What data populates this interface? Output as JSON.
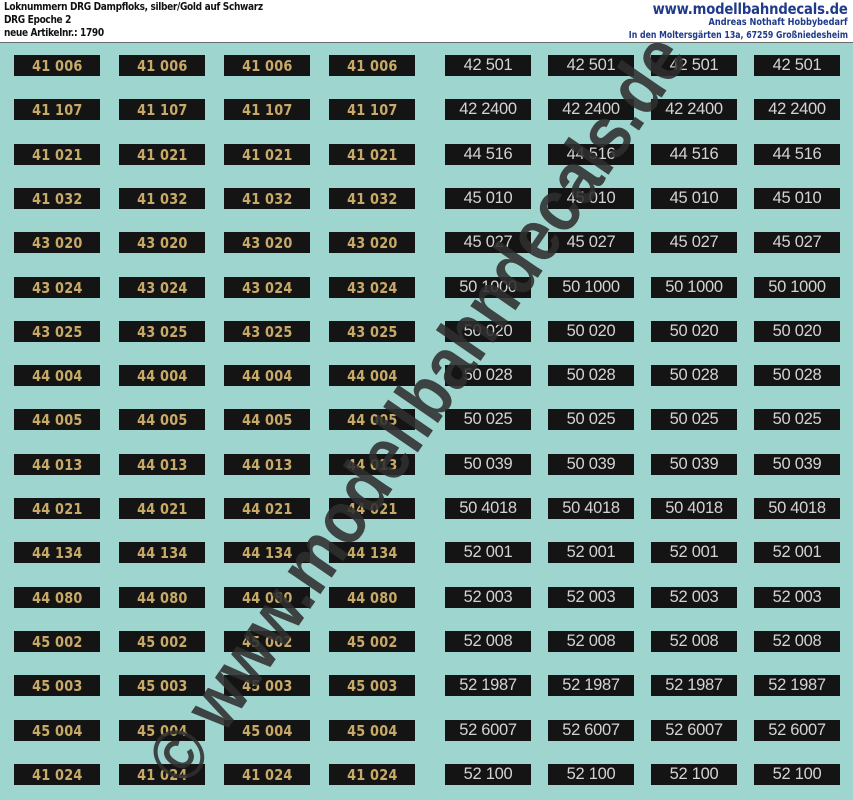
{
  "header": {
    "title_line1": "Loknummern DRG Dampfloks, silber/Gold auf Schwarz",
    "title_line2": "DRG Epoche 2",
    "title_line3": "neue Artikelnr.: 1790",
    "website": "www.modellbahndecals.de",
    "company": "Andreas Nothaft Hobbybedarf",
    "address": "In den Moltersgärten 13a, 67259 Großniedesheim"
  },
  "watermark": {
    "text": "© www.modellbahndecals.de",
    "color": "#2f2f2f"
  },
  "colors": {
    "sheet_background": "#9fd5cf",
    "decal_background": "#141414",
    "gold": "#c7a968",
    "silver": "#d3d3d3"
  },
  "gold_numbers": [
    "41 006",
    "41 107",
    "41 021",
    "41 032",
    "43 020",
    "43 024",
    "43 025",
    "44 004",
    "44 005",
    "44 013",
    "44 021",
    "44 134",
    "44 080",
    "45 002",
    "45 003",
    "45 004",
    "41 024"
  ],
  "silver_numbers": [
    "42 501",
    "42 2400",
    "44 516",
    "45 010",
    "45 027",
    "50 1000",
    "50 020",
    "50 028",
    "50 025",
    "50 039",
    "50 4018",
    "52 001",
    "52 003",
    "52 008",
    "52 1987",
    "52 6007",
    "52 100"
  ]
}
